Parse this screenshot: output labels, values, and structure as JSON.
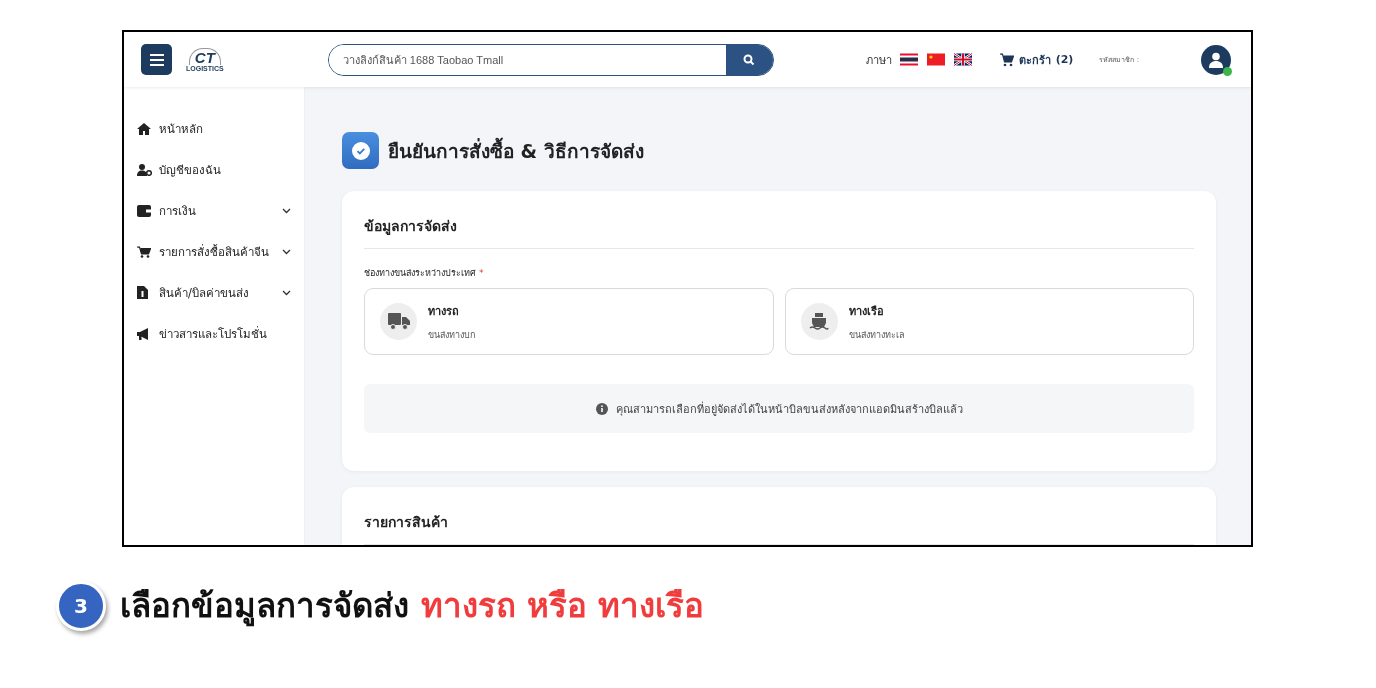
{
  "header": {
    "logo": {
      "mark": "CT",
      "name": "LOGISTICS"
    },
    "search": {
      "placeholder": "วางลิงก์สินค้า 1688 Taobao Tmall"
    },
    "language_label": "ภาษา",
    "cart": {
      "label": "ตะกร้า",
      "count": "(2)"
    },
    "member_label": "รหัสสมาชิก :",
    "avatar": {
      "online": true
    }
  },
  "sidebar": {
    "items": [
      {
        "label": "หน้าหลัก",
        "expandable": false
      },
      {
        "label": "บัญชีของฉัน",
        "expandable": false
      },
      {
        "label": "การเงิน",
        "expandable": true
      },
      {
        "label": "รายการสั่งซื้อสินค้าจีน",
        "expandable": true
      },
      {
        "label": "สินค้า/บิลค่าขนส่ง",
        "expandable": true
      },
      {
        "label": "ข่าวสารและโปรโมชั่น",
        "expandable": false
      }
    ]
  },
  "page_title": "ยืนยันการสั่งซื้อ & วิธีการจัดส่ง",
  "shipping_card": {
    "title": "ข้อมูลการจัดส่ง",
    "field_label": "ช่องทางขนส่งระหว่างประเทศ",
    "required_mark": "*",
    "options": [
      {
        "title": "ทางรถ",
        "subtitle": "ขนส่งทางบก",
        "selected": false
      },
      {
        "title": "ทางเรือ",
        "subtitle": "ขนส่งทางทะเล",
        "selected": false
      }
    ],
    "info": "คุณสามารถเลือกที่อยู่จัดส่งได้ในหน้าบิลขนส่งหลังจากแอดมินสร้างบิลแล้ว"
  },
  "items_card": {
    "title": "รายการสินค้า"
  },
  "caption": {
    "step": "3",
    "parts": [
      {
        "text": "เลือกข้อมูลการจัดส่ง",
        "highlight": false
      },
      {
        "text": "ทางรถ หรือ ทางเรือ",
        "highlight": true
      }
    ]
  }
}
